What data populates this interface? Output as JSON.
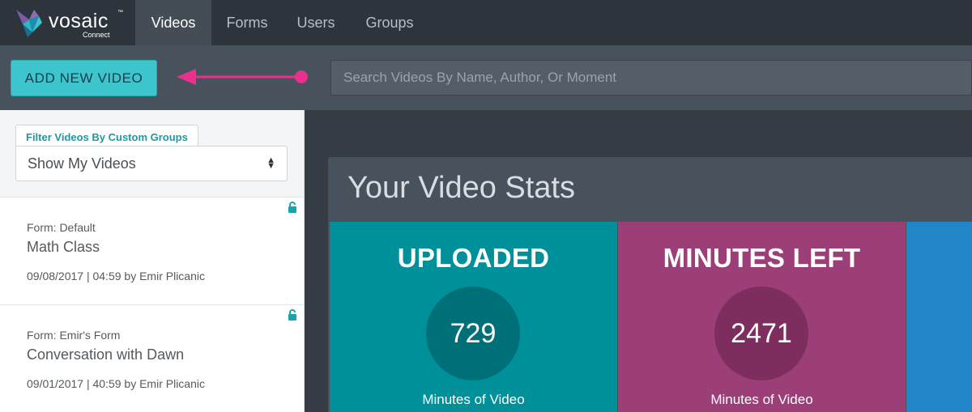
{
  "app": {
    "logo_text": "vosaic",
    "logo_tm": "™",
    "logo_sub": "Connect"
  },
  "nav": {
    "tabs": [
      {
        "label": "Videos",
        "active": true
      },
      {
        "label": "Forms",
        "active": false
      },
      {
        "label": "Users",
        "active": false
      },
      {
        "label": "Groups",
        "active": false
      }
    ]
  },
  "toolbar": {
    "add_label": "ADD NEW VIDEO",
    "search_placeholder": "Search Videos By Name, Author, Or Moment"
  },
  "sidebar": {
    "filter_label": "Filter Videos By Custom Groups",
    "filter_value": "Show My Videos",
    "videos": [
      {
        "form": "Form: Default",
        "title": "Math Class",
        "meta": "09/08/2017 | 04:59 by Emir Plicanic"
      },
      {
        "form": "Form: Emir's Form",
        "title": "Conversation with Dawn",
        "meta": "09/01/2017 | 40:59 by Emir Plicanic"
      }
    ]
  },
  "main": {
    "stats_title": "Your Video Stats",
    "stats": [
      {
        "label": "UPLOADED",
        "value": "729",
        "caption": "Minutes of Video"
      },
      {
        "label": "MINUTES LEFT",
        "value": "2471",
        "caption": "Minutes of Video"
      }
    ]
  },
  "colors": {
    "accent": "#3cc5cd",
    "annotation_arrow": "#e8308c",
    "uploaded_card": "#00909a",
    "uploaded_circle": "#007078",
    "minutes_card": "#9c3f78",
    "minutes_circle": "#7d2e5e",
    "third_card": "#2185c7"
  },
  "icons": {
    "lock": "unlock-icon",
    "select_caret": "sort-caret-icon",
    "arrow": "left-arrow-annotation-icon"
  }
}
